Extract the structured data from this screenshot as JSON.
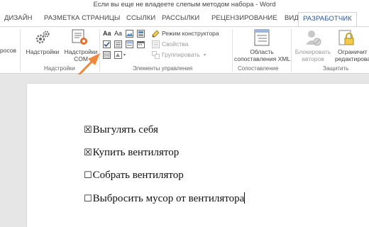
{
  "window": {
    "title": "Если вы еще не владеете слепым методом набора - Word"
  },
  "tabs": [
    {
      "label": "ДИЗАЙН",
      "active": false
    },
    {
      "label": "РАЗМЕТКА СТРАНИЦЫ",
      "active": false
    },
    {
      "label": "ССЫЛКИ",
      "active": false
    },
    {
      "label": "РАССЫЛКИ",
      "active": false
    },
    {
      "label": "РЕЦЕНЗИРОВАНИЕ",
      "active": false
    },
    {
      "label": "ВИД",
      "active": false
    },
    {
      "label": "РАЗРАБОТЧИК",
      "active": true
    }
  ],
  "ribbon": {
    "cut_left_label": "росов",
    "addins": {
      "label": "Надстройки",
      "com_label_1": "Надстройки",
      "com_label_2": "COM",
      "group": "Надстройки"
    },
    "controls": {
      "design_mode": "Режим конструктора",
      "properties": "Свойства",
      "group_btn": "Группировать",
      "group": "Элементы управления"
    },
    "mapping": {
      "label_1": "Область",
      "label_2": "сопоставления XML",
      "group": "Сопоставление"
    },
    "protect": {
      "block_1": "Блокировать",
      "block_2": "авторов",
      "restrict_1": "Ограничит",
      "restrict_2": "редактирован",
      "group": "Защитить"
    }
  },
  "document": {
    "lines": [
      {
        "checkbox": "☒",
        "text": "Выгулять себя"
      },
      {
        "checkbox": "☒",
        "text": "Купить вентилятор"
      },
      {
        "checkbox": "☐",
        "text": "Собрать вентилятор"
      },
      {
        "checkbox": "☐",
        "text": "Выбросить мусор от вентилятора"
      }
    ]
  },
  "colors": {
    "accent": "#2b579a",
    "arrow": "#f0883c"
  }
}
